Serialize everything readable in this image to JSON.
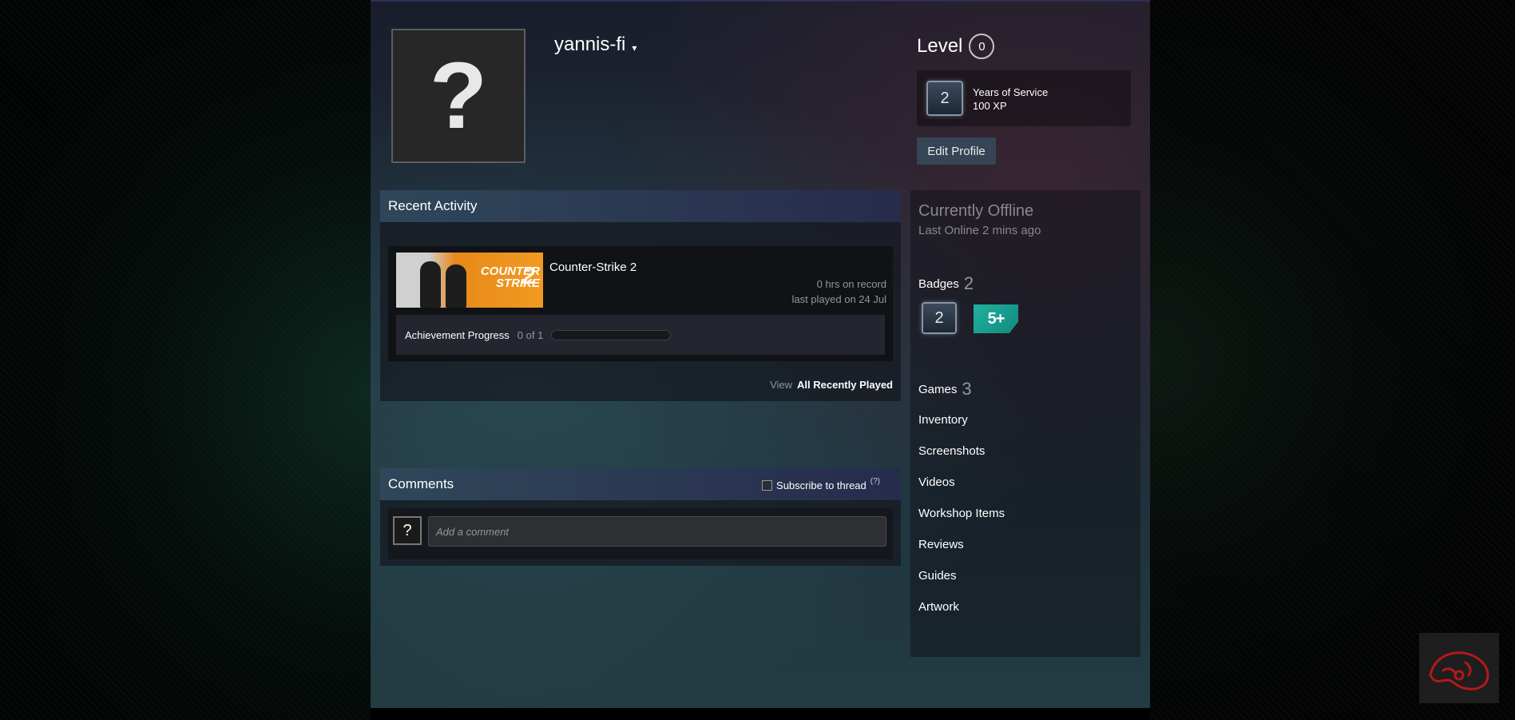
{
  "profile": {
    "avatar_glyph": "?",
    "persona_name": "yannis-fi",
    "persona_caret": "▾",
    "level_label": "Level",
    "level_value": "0",
    "badge": {
      "number": "2",
      "title": "Years of Service",
      "xp": "100 XP"
    },
    "edit_button": "Edit Profile"
  },
  "recent_activity": {
    "header": "Recent Activity",
    "game": {
      "art_line1": "COUNTER",
      "art_line2": "STRIKE",
      "art_num": "2",
      "name": "Counter-Strike 2",
      "hours": "0 hrs on record",
      "last_played": "last played on 24 Jul",
      "achievement_label": "Achievement Progress",
      "achievement_count": "0 of 1",
      "achievement_fraction": 0
    },
    "view_label": "View",
    "view_link": "All Recently Played"
  },
  "comments": {
    "header": "Comments",
    "subscribe_label": "Subscribe to thread",
    "help": "(?)",
    "avatar_glyph": "?",
    "placeholder": "Add a comment"
  },
  "sidebar": {
    "status": "Currently Offline",
    "last_online": "Last Online 2 mins ago",
    "badges_label": "Badges",
    "badges_count": "2",
    "badge1_number": "2",
    "badge2_label": "5+",
    "games_label": "Games",
    "games_count": "3",
    "links": [
      "Inventory",
      "Screenshots",
      "Videos",
      "Workshop Items",
      "Reviews",
      "Guides",
      "Artwork"
    ]
  },
  "colors": {
    "accent_badge_teal": "#1fb19f",
    "corner_logo_red": "#b4181b"
  },
  "icons": {
    "corner": "steering-wheel-icon"
  }
}
